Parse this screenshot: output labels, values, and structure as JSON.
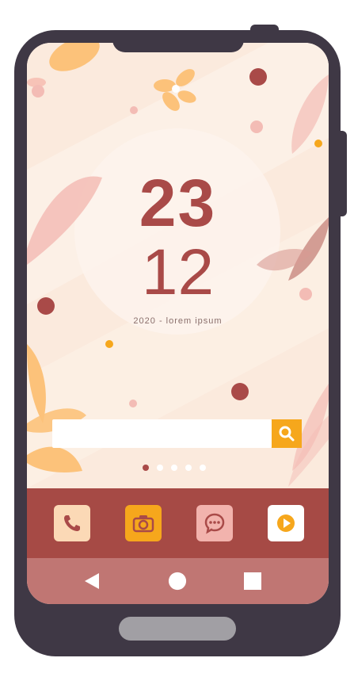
{
  "clock": {
    "hour": "23",
    "minute": "12",
    "subtitle": "2020 - lorem ipsum"
  },
  "search": {
    "placeholder": "",
    "button_icon": "search-icon"
  },
  "pager": {
    "total": 5,
    "active_index": 0
  },
  "dock": {
    "apps": [
      {
        "name": "phone",
        "icon": "phone-icon"
      },
      {
        "name": "camera",
        "icon": "camera-icon"
      },
      {
        "name": "messages",
        "icon": "chat-icon"
      },
      {
        "name": "player",
        "icon": "play-icon"
      }
    ]
  },
  "nav": {
    "back_icon": "back-triangle-icon",
    "home_icon": "home-circle-icon",
    "recent_icon": "recent-square-icon"
  },
  "colors": {
    "accent": "#a94a48",
    "orange": "#f6a71c",
    "dock": "#a64a45",
    "navbar": "#c07673",
    "frame": "#3f3845",
    "wallpaper": "#fbeadd"
  }
}
